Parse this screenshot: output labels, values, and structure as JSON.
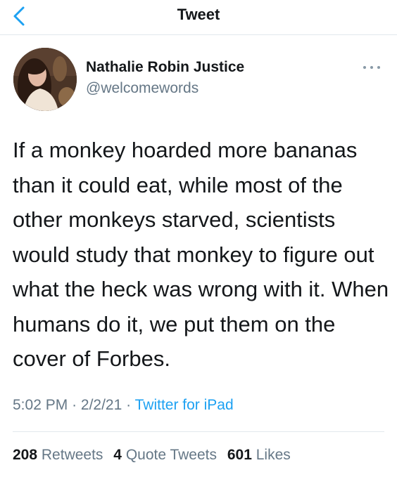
{
  "header": {
    "title": "Tweet",
    "back_icon": "chevron-left-icon",
    "accent_color": "#1da1f2"
  },
  "author": {
    "name": "Nathalie Robin Justice",
    "handle": "@welcomewords"
  },
  "tweet": {
    "text": "If a monkey hoarded more bananas than it could eat, while most of the other monkeys starved, scientists would study that monkey to figure out what the heck was wrong with it. When humans do it, we put them on the cover of Forbes."
  },
  "meta": {
    "time": "5:02 PM",
    "date": "2/2/21",
    "separator": "·",
    "source": "Twitter for iPad"
  },
  "stats": {
    "retweets_count": "208",
    "retweets_label": "Retweets",
    "quotes_count": "4",
    "quotes_label": "Quote Tweets",
    "likes_count": "601",
    "likes_label": "Likes"
  }
}
